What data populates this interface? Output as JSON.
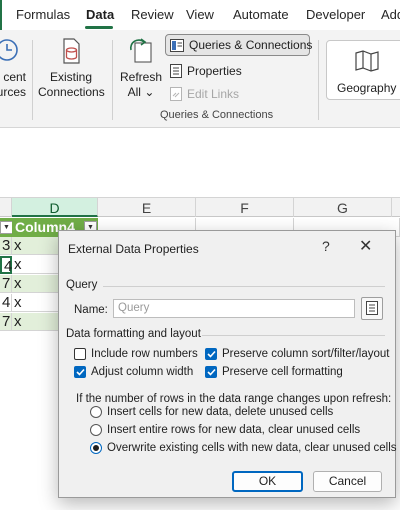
{
  "ribbon_tabs": [
    "Formulas",
    "Data",
    "Review",
    "View",
    "Automate",
    "Developer",
    "Add"
  ],
  "active_tab": "Data",
  "ribbon": {
    "partial_left_line1": "cent",
    "partial_left_line2": "urces",
    "existing_connections_line1": "Existing",
    "existing_connections_line2": "Connections",
    "refresh_all_line1": "Refresh",
    "refresh_all_line2": "All",
    "refresh_all_chevron": "⌄",
    "queries_connections": "Queries & Connections",
    "properties": "Properties",
    "edit_links": "Edit Links",
    "group_label": "Queries & Connections",
    "geography": "Geography"
  },
  "sheet": {
    "columns": [
      "D",
      "E",
      "F",
      "G"
    ],
    "header_cell": "Column4",
    "row_values_left": [
      "3",
      "4",
      "7",
      "4",
      "7"
    ],
    "row_values_d": [
      "x",
      "x",
      "x",
      "x",
      "x"
    ]
  },
  "dialog": {
    "title": "External Data Properties",
    "help": "?",
    "close": "✕",
    "query_section": "Query",
    "name_label": "Name:",
    "name_placeholder": "Query",
    "formatting_section": "Data formatting and layout",
    "include_row_numbers": "Include row numbers",
    "preserve_sort": "Preserve column sort/filter/layout",
    "adjust_column_width": "Adjust column width",
    "preserve_cell_formatting": "Preserve cell formatting",
    "refresh_question": "If the number of rows in the data range changes upon refresh:",
    "radio_insert_cells": "Insert cells for new data, delete unused cells",
    "radio_insert_rows": "Insert entire rows for new data, clear unused cells",
    "radio_overwrite": "Overwrite existing cells with new data, clear unused cells",
    "ok": "OK",
    "cancel": "Cancel"
  },
  "colors": {
    "accent_green": "#217346",
    "table_header": "#70ad47",
    "band_row": "#e2efda",
    "checkbox_blue": "#0067c0"
  }
}
